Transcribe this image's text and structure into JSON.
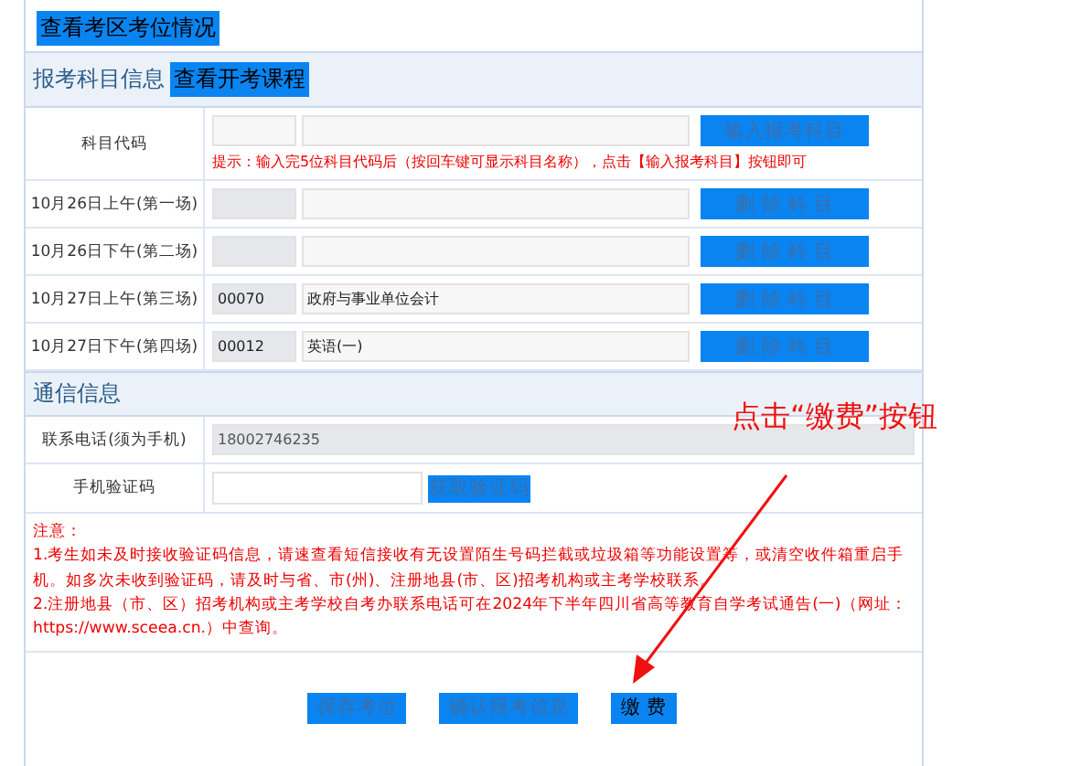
{
  "top_link": "查看考区考位情况",
  "subject_section": {
    "title": "报考科目信息",
    "link": "查看开考课程"
  },
  "code_row": {
    "label": "科目代码",
    "button": "输入报考科目",
    "hint": "提示：输入完5位科目代码后（按回车键可显示科目名称），点击【输入报考科目】按钮即可"
  },
  "sessions": [
    {
      "label": "10月26日上午(第一场)",
      "button": "删 除 科 目"
    },
    {
      "label": "10月26日下午(第二场)",
      "button": "删 除 科 目"
    },
    {
      "label": "10月27日上午(第三场)",
      "code": "00070",
      "name": "政府与事业单位会计",
      "button": "删 除 科 目"
    },
    {
      "label": "10月27日下午(第四场)",
      "code": "00012",
      "name": "英语(一)",
      "button": "删 除 科 目"
    }
  ],
  "contact_section": {
    "title": "通信信息"
  },
  "phone": {
    "label": "联系电话(须为手机)",
    "value": "18002746235"
  },
  "verify": {
    "label": "手机验证码",
    "button": "获取验证码"
  },
  "notes": [
    "注意：",
    "1.考生如未及时接收验证码信息，请速查看短信接收有无设置陌生号码拦截或垃圾箱等功能设置等，或清空收件箱重启手机。如多次未收到验证码，请及时与省、市(州)、注册地县(市、区)招考机构或主考学校联系。",
    "2.注册地县（市、区）招考机构或主考学校自考办联系电话可在2024年下半年四川省高等教育自学考试通告(一)（网址：https://www.sceea.cn.）中查询。"
  ],
  "buttons": [
    {
      "label": "保存考位",
      "disabled": true
    },
    {
      "label": "确认报考信息",
      "disabled": true
    },
    {
      "label": "缴 费",
      "disabled": false
    }
  ],
  "annotation": {
    "text": "点击“缴费”按钮"
  }
}
